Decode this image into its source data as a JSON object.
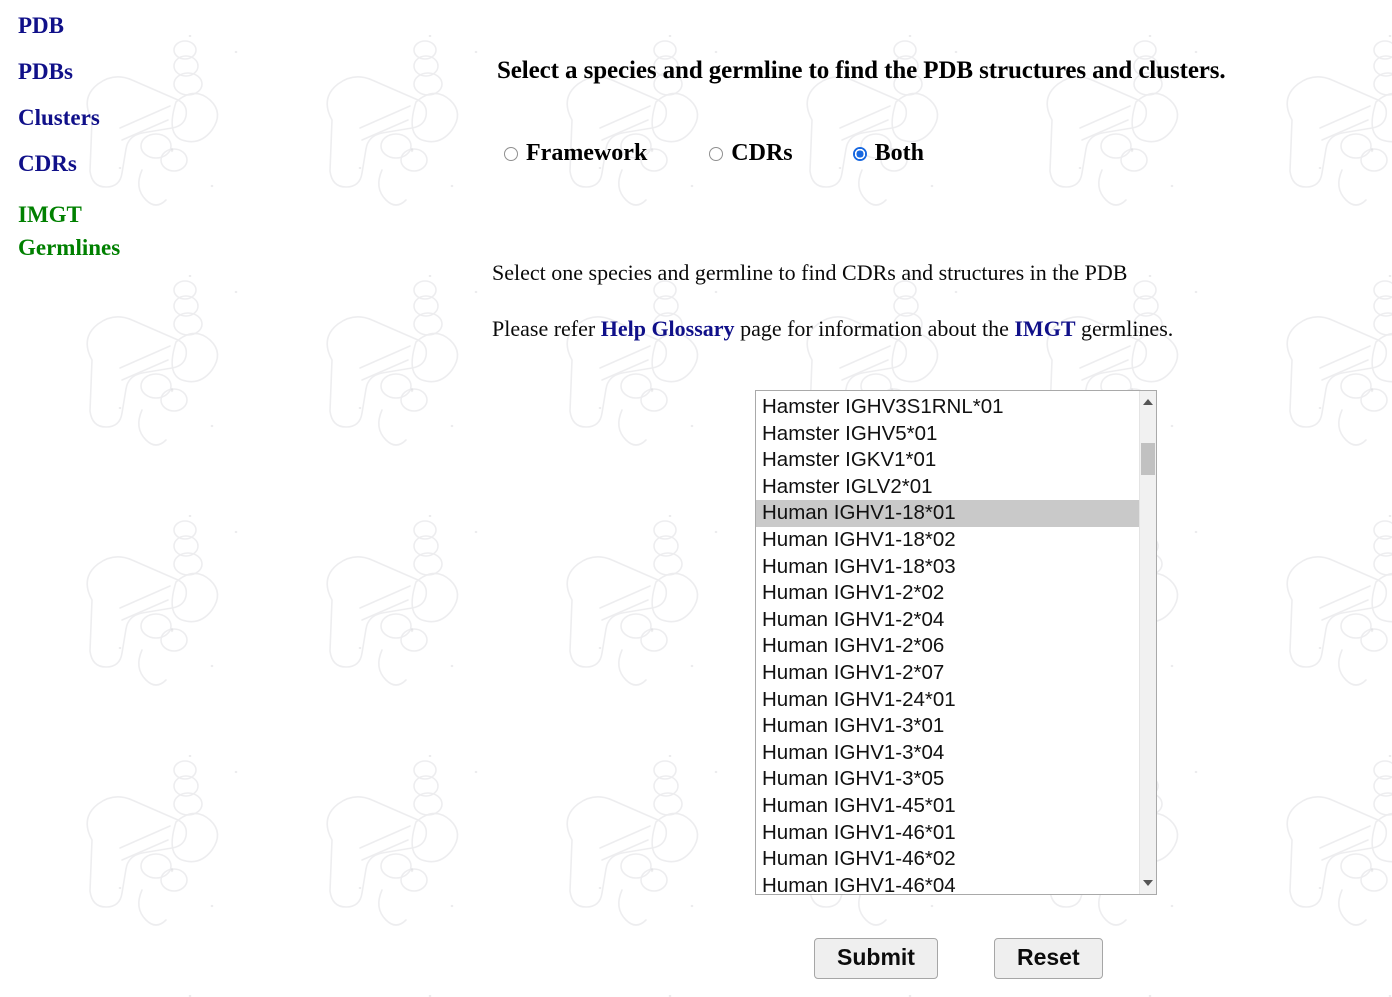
{
  "sidebar": {
    "items": [
      {
        "label": "PDB",
        "active": false
      },
      {
        "label": "PDBs",
        "active": false
      },
      {
        "label": "Clusters",
        "active": false
      },
      {
        "label": "CDRs",
        "active": false
      },
      {
        "label": "IMGT\nGermlines",
        "active": true
      }
    ]
  },
  "main": {
    "title": "Select a species and germline to find the PDB structures and clusters.",
    "radio_group": {
      "options": [
        {
          "label": "Framework",
          "checked": false
        },
        {
          "label": "CDRs",
          "checked": false
        },
        {
          "label": "Both",
          "checked": true
        }
      ]
    },
    "instruction": "Select one species and germline to find CDRs and structures in the PDB",
    "glossary_note": {
      "prefix": "Please refer ",
      "link1": "Help Glossary",
      "middle": " page for information about the ",
      "link2": "IMGT",
      "suffix": " germlines."
    },
    "listbox": {
      "selected": "Human IGHV1-18*01",
      "options": [
        "Hamster IGHV3S1RNL*01",
        "Hamster IGHV5*01",
        "Hamster IGKV1*01",
        "Hamster IGLV2*01",
        "Human IGHV1-18*01",
        "Human IGHV1-18*02",
        "Human IGHV1-18*03",
        "Human IGHV1-2*02",
        "Human IGHV1-2*04",
        "Human IGHV1-2*06",
        "Human IGHV1-2*07",
        "Human IGHV1-24*01",
        "Human IGHV1-3*01",
        "Human IGHV1-3*04",
        "Human IGHV1-3*05",
        "Human IGHV1-45*01",
        "Human IGHV1-46*01",
        "Human IGHV1-46*02",
        "Human IGHV1-46*04"
      ]
    },
    "buttons": {
      "submit": "Submit",
      "reset": "Reset"
    }
  },
  "colors": {
    "nav_link": "#101089",
    "nav_active": "#008000",
    "radio_checked": "#1868e0",
    "selected_row": "#c9c9c9",
    "button_face": "#efefef"
  }
}
